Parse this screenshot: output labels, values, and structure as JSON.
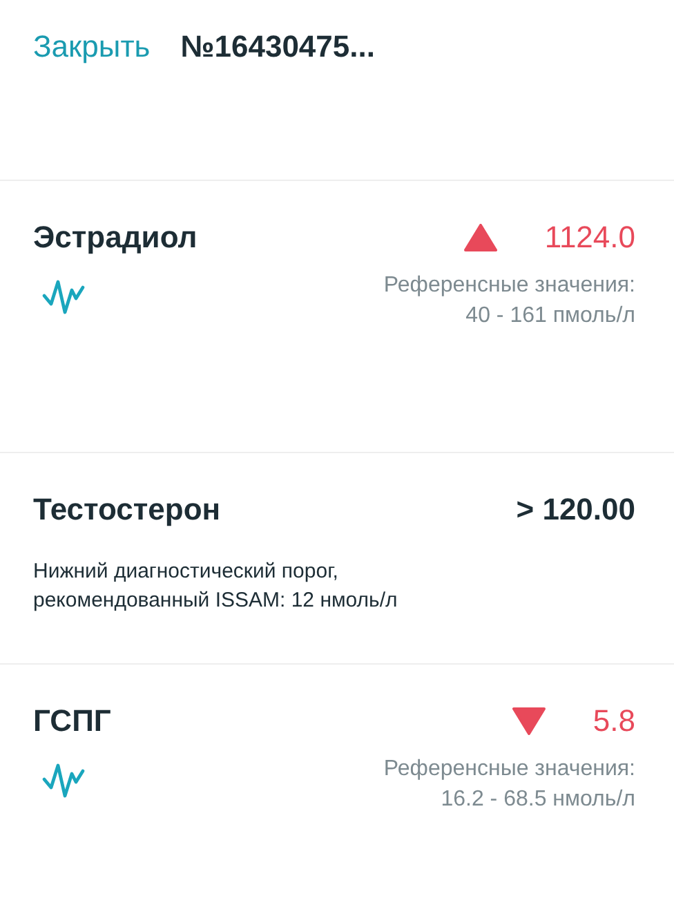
{
  "header": {
    "close_link": "Закрыть",
    "title": "№16430475..."
  },
  "results": [
    {
      "name": "Эстрадиол",
      "kind": "high",
      "value": "1124.0",
      "chart": true,
      "reference_label": "Референсные значения:",
      "reference_range": "40 - 161 пмоль/л"
    },
    {
      "name": "Тестостерон",
      "kind": "normal",
      "value": "> 120.00",
      "chart": false,
      "note": "Нижний диагностический порог, рекомендованный ISSAM: 12 нмоль/л"
    },
    {
      "name": "ГСПГ",
      "kind": "low",
      "value": "5.8",
      "chart": true,
      "reference_label": "Референсные значения:",
      "reference_range": "16.2 - 68.5 нмоль/л"
    }
  ]
}
